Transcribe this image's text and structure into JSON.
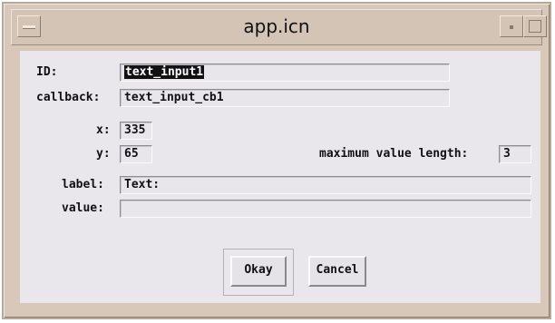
{
  "window": {
    "title": "app.icn"
  },
  "form": {
    "id": {
      "label": "ID:",
      "value": "text_input1"
    },
    "callback": {
      "label": "callback:",
      "value": "text_input_cb1"
    },
    "x": {
      "label": "x:",
      "value": "335"
    },
    "y": {
      "label": "y:",
      "value": "65"
    },
    "max_length": {
      "label": "maximum value length:",
      "value": "3"
    },
    "text_label": {
      "label": "label:",
      "value": "Text:"
    },
    "text_value": {
      "label": "value:",
      "value": ""
    }
  },
  "buttons": {
    "okay": "Okay",
    "cancel": "Cancel"
  }
}
